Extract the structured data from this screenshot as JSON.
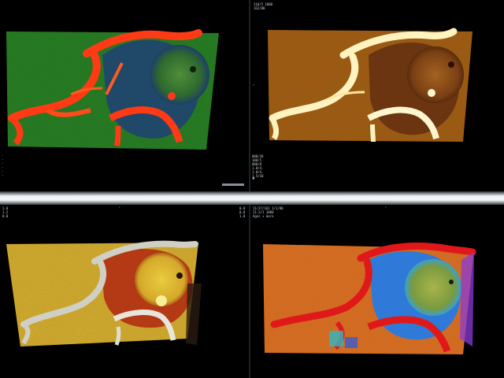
{
  "viewports": [
    {
      "id": "top-left",
      "colormap": "green-orange"
    },
    {
      "id": "top-right",
      "colormap": "copper"
    },
    {
      "id": "bottom-left",
      "colormap": "yellow-red"
    },
    {
      "id": "bottom-right",
      "colormap": "rainbow"
    }
  ],
  "overlays": {
    "top_right_header": "110/5 1000\n162/88",
    "top_right_info": "000/10\n100/5\n000/8\n1.0/4.\n1.0/4.\n1.5/10",
    "bottom_right_header": "11/27/161 1/1/00\n21:2/1 1000\nAges + more",
    "bottom_left_header": "1.0\n1.2\n0.0",
    "bottom_left_side": "0.0\n0.0\n1.0"
  },
  "colors": {
    "background": "#000000",
    "divider": "#f2f5f7",
    "overlay_text": "#c8d0d8"
  }
}
